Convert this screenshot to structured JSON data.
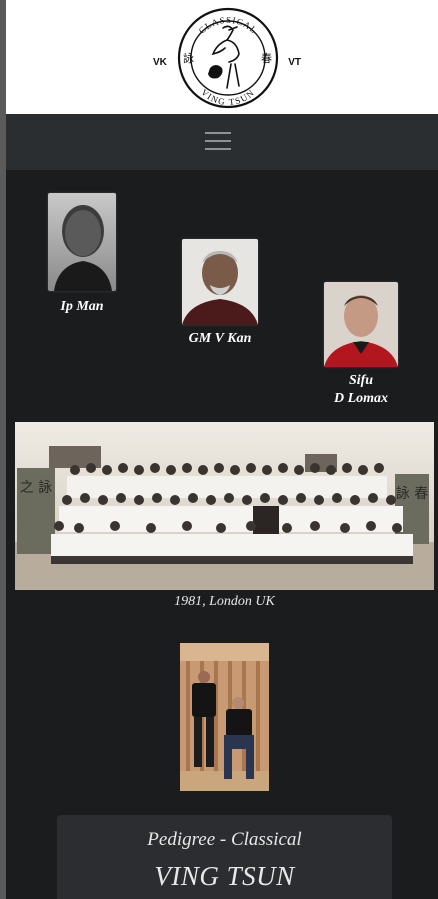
{
  "logo": {
    "top_text": "CLASSICAL",
    "bottom_text": "VING TSUN",
    "left_text": "VK",
    "right_text": "VT",
    "left_glyph": "詠",
    "right_glyph": "春"
  },
  "nav": {
    "menu_icon": "hamburger-icon"
  },
  "lineage": [
    {
      "caption": "Ip Man"
    },
    {
      "caption": "GM V Kan"
    },
    {
      "caption_line1": "Sifu",
      "caption_line2": "D Lomax"
    }
  ],
  "group_photo": {
    "caption": "1981, London UK",
    "banner_left": "之 詠",
    "banner_right": "詠 春"
  },
  "pedigree": {
    "subtitle": "Pedigree - Classical",
    "title": "VING TSUN"
  },
  "colors": {
    "page_bg": "#1b1c1e",
    "navbar_bg": "#2b2e31",
    "card_bg": "#2b2d30",
    "header_bg": "#ffffff"
  }
}
